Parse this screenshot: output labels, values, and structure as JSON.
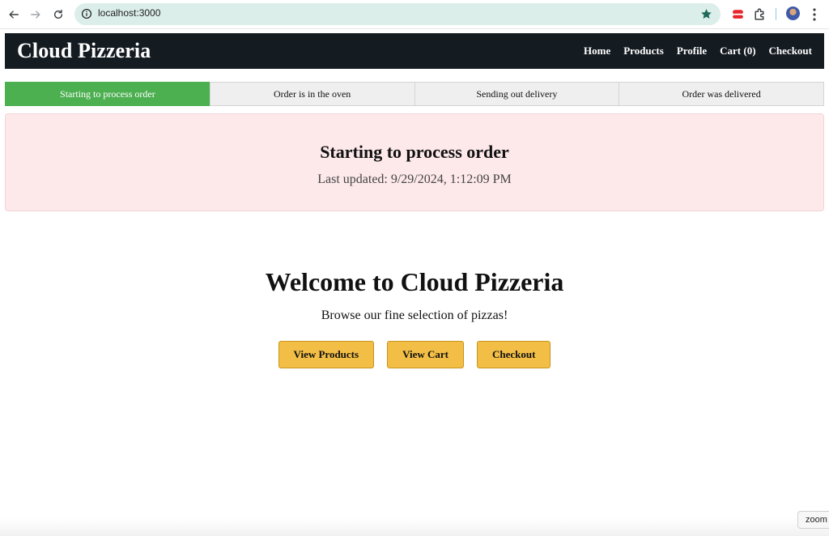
{
  "browser": {
    "url": "localhost:3000",
    "icons": [
      "back-arrow-icon",
      "forward-arrow-icon",
      "reload-icon",
      "site-info-icon",
      "bookmark-star-icon",
      "extension-icon",
      "puzzle-icon",
      "profile-avatar",
      "menu-kebab-icon"
    ]
  },
  "header": {
    "brand": "Cloud Pizzeria",
    "nav": [
      {
        "label": "Home"
      },
      {
        "label": "Products"
      },
      {
        "label": "Profile"
      },
      {
        "label": "Cart (0)"
      },
      {
        "label": "Checkout"
      }
    ],
    "background": "#141b21"
  },
  "progress": {
    "steps": [
      {
        "label": "Starting to process order",
        "active": true
      },
      {
        "label": "Order is in the oven",
        "active": false
      },
      {
        "label": "Sending out delivery",
        "active": false
      },
      {
        "label": "Order was delivered",
        "active": false
      }
    ],
    "active_color": "#4caf50"
  },
  "status": {
    "title": "Starting to process order",
    "updated": "Last updated: 9/29/2024, 1:12:09 PM",
    "background": "#fde8ea"
  },
  "hero": {
    "title": "Welcome to Cloud Pizzeria",
    "subtitle": "Browse our fine selection of pizzas!",
    "buttons": [
      {
        "label": "View Products"
      },
      {
        "label": "View Cart"
      },
      {
        "label": "Checkout"
      }
    ],
    "button_color": "#f2be45"
  },
  "zoom_chip": {
    "label": "zoom"
  }
}
